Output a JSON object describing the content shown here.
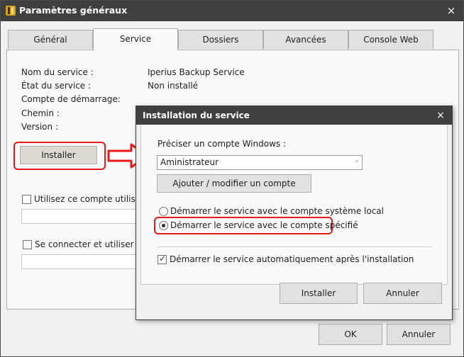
{
  "window": {
    "title": "Paramètres généraux",
    "close_icon": "×"
  },
  "tabs": [
    {
      "label": "Général",
      "active": false
    },
    {
      "label": "Service",
      "active": true
    },
    {
      "label": "Dossiers",
      "active": false
    },
    {
      "label": "Avancées",
      "active": false
    },
    {
      "label": "Console Web",
      "active": false
    }
  ],
  "service_info": {
    "name_label": "Nom du service :",
    "name_value": "Iperius Backup Service",
    "state_label": "État du service :",
    "state_value": "Non installé",
    "startup_account_label": "Compte de démarrage:",
    "path_label": "Chemin :",
    "version_label": "Version :",
    "install_button": "Installer"
  },
  "options": {
    "use_account_label": "Utilisez ce compte utilisateur po",
    "connect_label": "Se connecter et utiliser l'identi"
  },
  "footer": {
    "ok_label": "OK",
    "cancel_label": "Annuler"
  },
  "dialog": {
    "title": "Installation du service",
    "close_icon": "×",
    "account_prompt": "Préciser un compte Windows :",
    "account_value": "Aministrateur",
    "add_account_button": "Ajouter / modifier un compte",
    "radio_local": "Démarrer le service avec le compte système local",
    "radio_specified": "Démarrer le service avec le compte spécifié",
    "auto_start_label": "Démarrer le service automatiquement après l'installation",
    "auto_start_checked": true,
    "install_button": "Installer",
    "cancel_button": "Annuler"
  },
  "colors": {
    "titlebar": "#404040",
    "highlight_red": "#e21a1a"
  }
}
